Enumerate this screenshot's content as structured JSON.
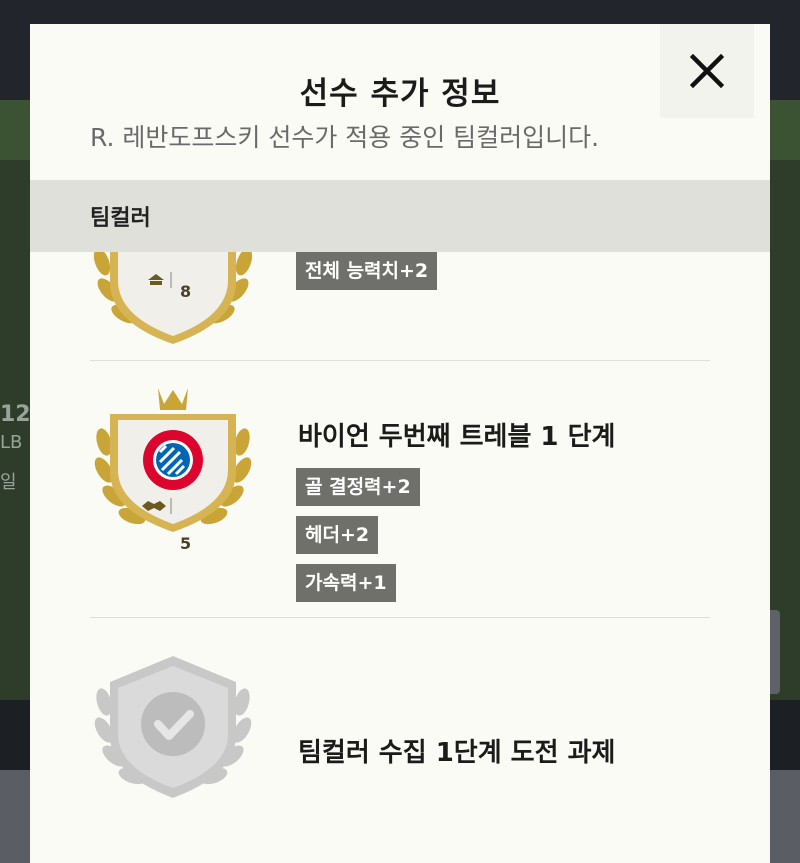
{
  "modal": {
    "title": "선수 추가 정보",
    "subtitle": "R. 레반도프스키 선수가 적용 중인 팀컬러입니다.",
    "section_header": "팀컬러"
  },
  "items": [
    {
      "level": "8",
      "tags": [
        "전체 능력치+2"
      ]
    },
    {
      "title": "바이언 두번째 트레블 1 단계",
      "level": "5",
      "tags": [
        "골 결정력+2",
        "헤더+2",
        "가속력+1"
      ],
      "badge_color": "#c9a537"
    },
    {
      "title": "팀컬러 수집 1단계 도전 과제",
      "badge_color": "#c8c8c8"
    }
  ],
  "background": {
    "partial_number": "12",
    "partial_position": "LB",
    "partial_label": "일"
  },
  "colors": {
    "accent_gold": "#c9a537",
    "tag_bg": "#6f6f6b",
    "header_bg": "#e0e0db",
    "modal_bg": "#fbfbf6"
  },
  "icons": [
    "close-icon",
    "crown-icon",
    "laurel-icon",
    "handshake-icon",
    "check-icon",
    "shield-icon"
  ]
}
